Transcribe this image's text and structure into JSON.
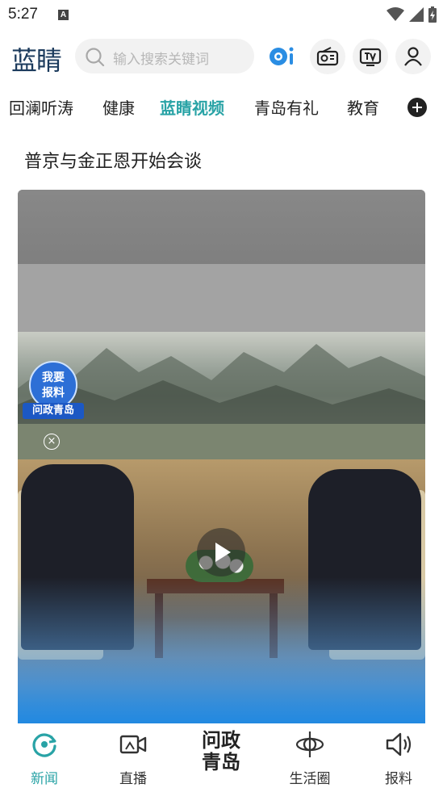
{
  "status_bar": {
    "time": "5:27",
    "indicator": "A",
    "icons": [
      "wifi-icon",
      "signal-icon",
      "battery-charging-icon"
    ]
  },
  "header": {
    "logo_text": "蓝睛",
    "search_placeholder": "输入搜索关键词",
    "actions": [
      "ai-assistant-icon",
      "radio-icon",
      "tv-icon",
      "user-icon"
    ],
    "ai_label": "ai"
  },
  "tabs": {
    "items": [
      "回澜听涛",
      "健康",
      "蓝睛视频",
      "青岛有礼",
      "教育"
    ],
    "active": "蓝睛视频"
  },
  "article": {
    "title": "普京与金正恩开始会谈",
    "badge_line1": "我要",
    "badge_line2": "报料",
    "badge_brand": "问政青岛",
    "close_glyph": "×"
  },
  "bottom_nav": {
    "items": [
      {
        "label": "新闻",
        "icon": "news-icon",
        "active": true
      },
      {
        "label": "直播",
        "icon": "live-camera-icon",
        "active": false
      },
      {
        "label": "生活圈",
        "icon": "life-circle-icon",
        "active": false
      },
      {
        "label": "报料",
        "icon": "megaphone-icon",
        "active": false
      }
    ],
    "center_brand_line1": "问政",
    "center_brand_line2": "青岛"
  },
  "colors": {
    "accent": "#29a3a6",
    "logo": "#1b3a5c",
    "ai_blue": "#2a8de3"
  }
}
